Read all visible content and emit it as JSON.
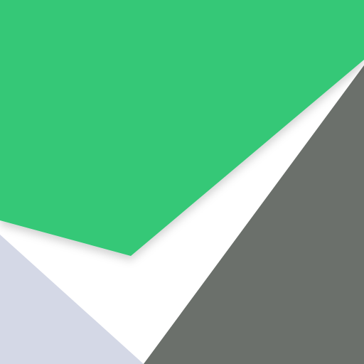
{
  "graphic": {
    "type": "abstract-geometric-logo",
    "colors": {
      "background": "#ffffff",
      "green": "#34c877",
      "dark_gray": "#6b706b",
      "light_lavender_gray": "#d4d8e6",
      "shadow": "#000000"
    }
  }
}
